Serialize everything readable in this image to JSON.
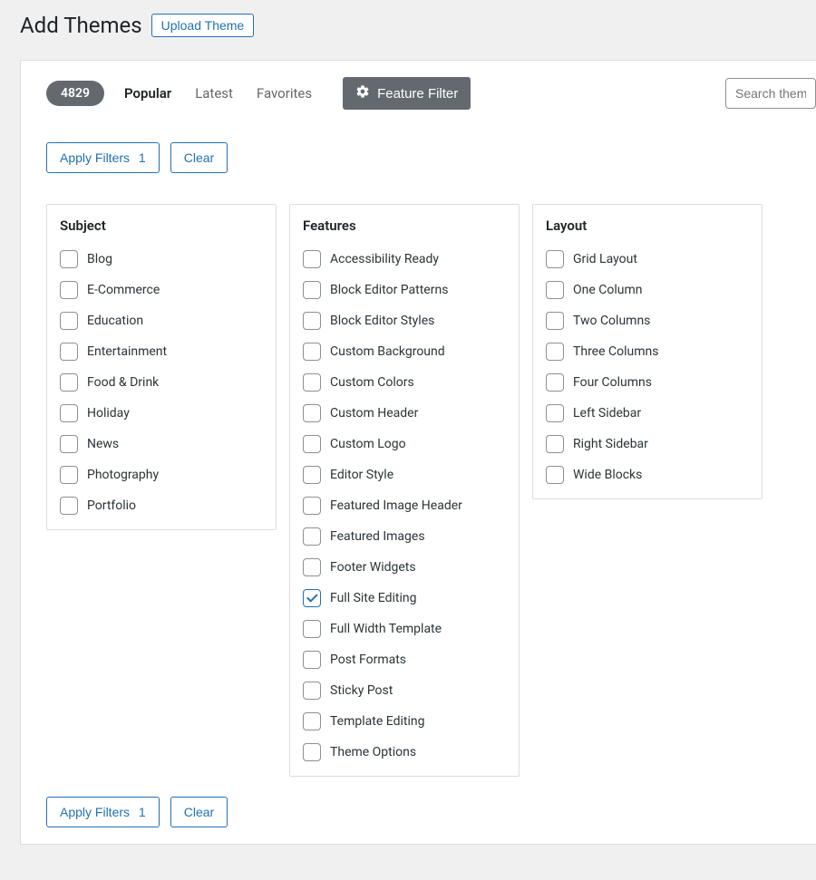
{
  "header": {
    "title": "Add Themes",
    "upload_label": "Upload Theme"
  },
  "tabs": {
    "count": "4829",
    "popular": "Popular",
    "latest": "Latest",
    "favorites": "Favorites",
    "feature_filter": "Feature Filter"
  },
  "search": {
    "placeholder": "Search themes..."
  },
  "actions": {
    "apply": "Apply Filters",
    "apply_count": "1",
    "clear": "Clear"
  },
  "filters": {
    "subject": {
      "heading": "Subject",
      "items": [
        {
          "label": "Blog",
          "checked": false
        },
        {
          "label": "E-Commerce",
          "checked": false
        },
        {
          "label": "Education",
          "checked": false
        },
        {
          "label": "Entertainment",
          "checked": false
        },
        {
          "label": "Food & Drink",
          "checked": false
        },
        {
          "label": "Holiday",
          "checked": false
        },
        {
          "label": "News",
          "checked": false
        },
        {
          "label": "Photography",
          "checked": false
        },
        {
          "label": "Portfolio",
          "checked": false
        }
      ]
    },
    "features": {
      "heading": "Features",
      "items": [
        {
          "label": "Accessibility Ready",
          "checked": false
        },
        {
          "label": "Block Editor Patterns",
          "checked": false
        },
        {
          "label": "Block Editor Styles",
          "checked": false
        },
        {
          "label": "Custom Background",
          "checked": false
        },
        {
          "label": "Custom Colors",
          "checked": false
        },
        {
          "label": "Custom Header",
          "checked": false
        },
        {
          "label": "Custom Logo",
          "checked": false
        },
        {
          "label": "Editor Style",
          "checked": false
        },
        {
          "label": "Featured Image Header",
          "checked": false
        },
        {
          "label": "Featured Images",
          "checked": false
        },
        {
          "label": "Footer Widgets",
          "checked": false
        },
        {
          "label": "Full Site Editing",
          "checked": true
        },
        {
          "label": "Full Width Template",
          "checked": false
        },
        {
          "label": "Post Formats",
          "checked": false
        },
        {
          "label": "Sticky Post",
          "checked": false
        },
        {
          "label": "Template Editing",
          "checked": false
        },
        {
          "label": "Theme Options",
          "checked": false
        }
      ]
    },
    "layout": {
      "heading": "Layout",
      "items": [
        {
          "label": "Grid Layout",
          "checked": false
        },
        {
          "label": "One Column",
          "checked": false
        },
        {
          "label": "Two Columns",
          "checked": false
        },
        {
          "label": "Three Columns",
          "checked": false
        },
        {
          "label": "Four Columns",
          "checked": false
        },
        {
          "label": "Left Sidebar",
          "checked": false
        },
        {
          "label": "Right Sidebar",
          "checked": false
        },
        {
          "label": "Wide Blocks",
          "checked": false
        }
      ]
    }
  }
}
